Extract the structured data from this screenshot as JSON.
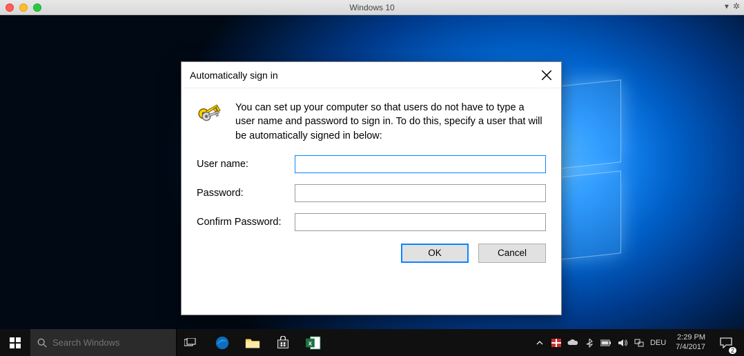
{
  "mac_window": {
    "title": "Windows 10"
  },
  "dialog": {
    "title": "Automatically sign in",
    "description": "You can set up your computer so that users do not have to type a user name and password to sign in. To do this, specify a user that will be automatically signed in below:",
    "fields": {
      "username_label": "User name:",
      "username_value": "",
      "password_label": "Password:",
      "password_value": "",
      "confirm_label": "Confirm Password:",
      "confirm_value": ""
    },
    "buttons": {
      "ok": "OK",
      "cancel": "Cancel"
    }
  },
  "taskbar": {
    "search_placeholder": "Search Windows",
    "apps": [
      "edge",
      "file-explorer",
      "store",
      "excel"
    ],
    "tray": {
      "lang": "DEU",
      "time": "2:29 PM",
      "date": "7/4/2017",
      "notif_count": "2"
    }
  }
}
